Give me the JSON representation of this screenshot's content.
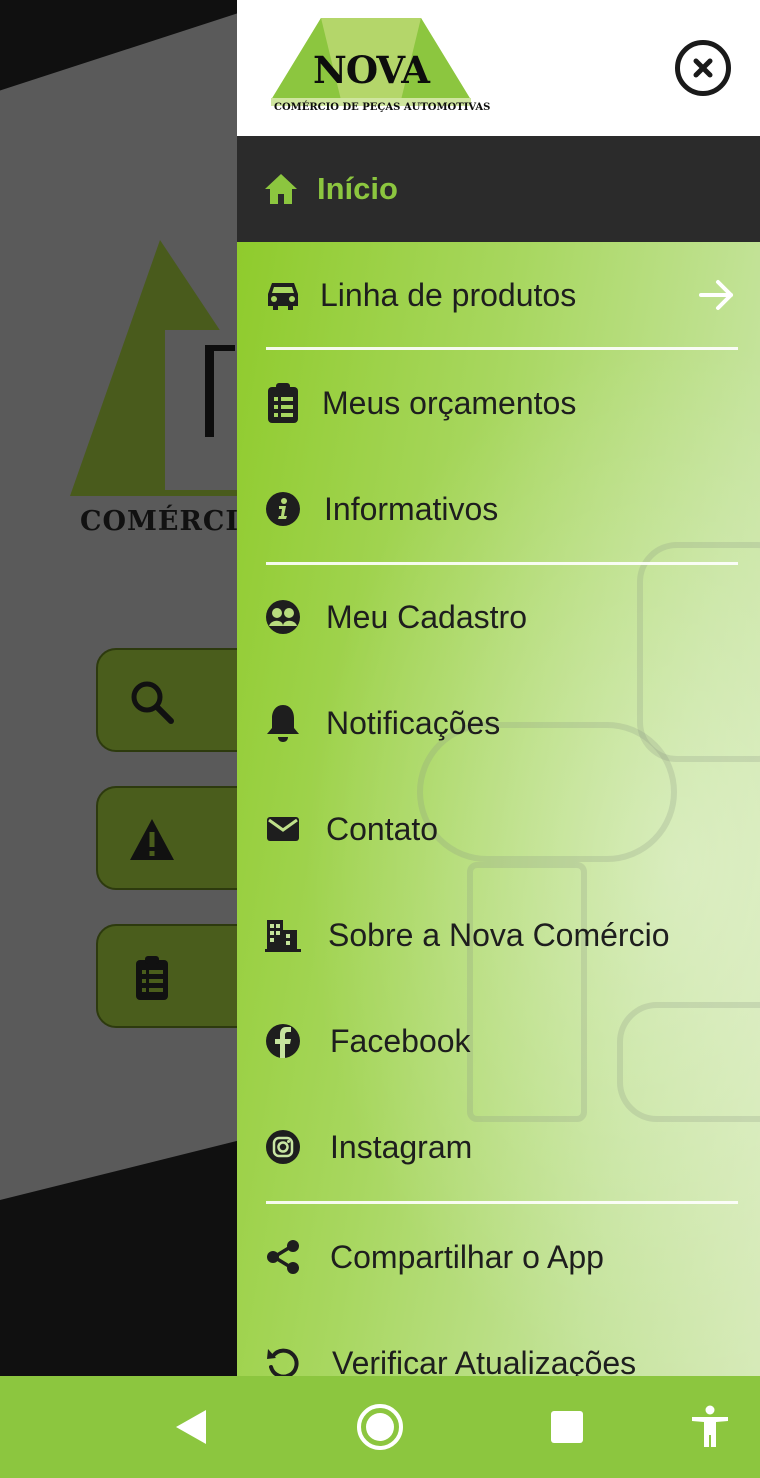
{
  "background_app": {
    "logo_text": "COMÉRCI"
  },
  "drawer": {
    "brand": {
      "name": "NOVA",
      "subtitle": "COMÉRCIO DE PEÇAS AUTOMOTIVAS"
    },
    "close_icon": "close-circle-icon",
    "home": {
      "label": "Início",
      "icon": "home-icon"
    },
    "items": [
      {
        "label": "Linha de produtos",
        "icon": "car-icon",
        "trailing": "arrow-right-icon"
      },
      {
        "label": "Meus orçamentos",
        "icon": "clipboard-list-icon"
      },
      {
        "label": "Informativos",
        "icon": "info-icon"
      },
      {
        "label": "Meu Cadastro",
        "icon": "users-icon"
      },
      {
        "label": "Notificações",
        "icon": "bell-icon"
      },
      {
        "label": "Contato",
        "icon": "envelope-icon"
      },
      {
        "label": "Sobre a Nova Comércio",
        "icon": "building-icon"
      },
      {
        "label": "Facebook",
        "icon": "facebook-icon"
      },
      {
        "label": "Instagram",
        "icon": "instagram-icon"
      },
      {
        "label": "Compartilhar o App",
        "icon": "share-icon"
      },
      {
        "label": "Verificar Atualizações",
        "icon": "refresh-icon"
      }
    ],
    "colors": {
      "accent": "#8cc63f",
      "home_bg": "#2b2b2b",
      "text": "#1e1e1e"
    }
  },
  "navbar": {
    "buttons": [
      "back-icon",
      "home-circle-icon",
      "recents-icon",
      "accessibility-icon"
    ]
  }
}
